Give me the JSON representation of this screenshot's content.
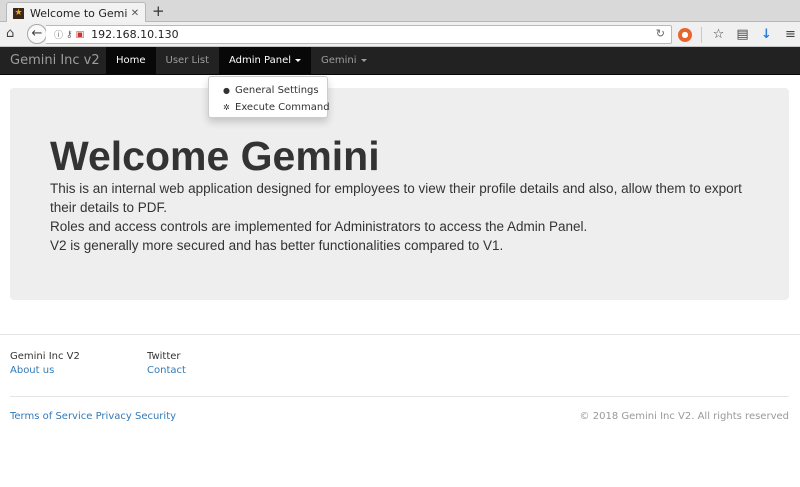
{
  "browser": {
    "tab_title": "Welcome to Gemini I...",
    "url": "192.168.10.130"
  },
  "site": {
    "brand": "Gemini Inc v2",
    "nav": [
      {
        "label": "Home"
      },
      {
        "label": "User List"
      },
      {
        "label": "Admin Panel"
      },
      {
        "label": "Gemini"
      }
    ],
    "admin_dropdown": [
      {
        "label": "General Settings",
        "icon": "user-icon"
      },
      {
        "label": "Execute Command",
        "icon": "gear-icon"
      }
    ]
  },
  "jumbotron": {
    "heading": "Welcome Gemini",
    "lines": [
      "This is an internal web application designed for employees to view their profile details and also, allow them to export their details to PDF.",
      "Roles and access controls are implemented for Administrators to access the Admin Panel.",
      "V2 is generally more secured and has better functionalities compared to V1."
    ]
  },
  "footer": {
    "col1_heading": "Gemini Inc V2",
    "col1_link": "About us",
    "col2_heading": "Twitter",
    "col2_link": "Contact",
    "legal": "Terms of Service Privacy Security",
    "copyright": "© 2018 Gemini Inc V2. All rights reserved"
  }
}
